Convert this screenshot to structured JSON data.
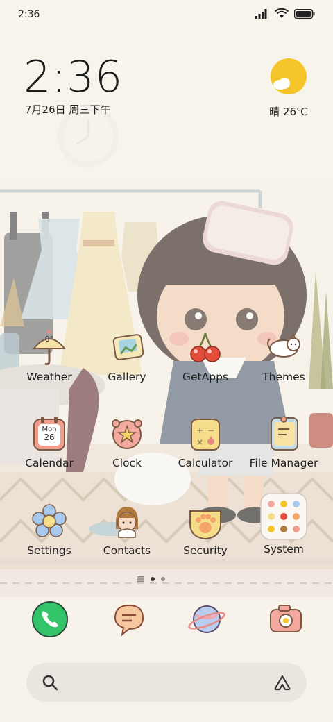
{
  "status_bar": {
    "time": "2:36"
  },
  "widget": {
    "clock": "2:36",
    "date": "7月26日 周三下午",
    "weather_text": "晴 26℃"
  },
  "apps": [
    {
      "label": "Weather",
      "icon": "weather-icon",
      "badge": "0°"
    },
    {
      "label": "Gallery",
      "icon": "gallery-icon"
    },
    {
      "label": "GetApps",
      "icon": "cherry-icon"
    },
    {
      "label": "Themes",
      "icon": "cat-icon"
    },
    {
      "label": "Calendar",
      "icon": "calendar-icon",
      "cal_top": "Mon",
      "cal_day": "26"
    },
    {
      "label": "Clock",
      "icon": "clock-star-icon"
    },
    {
      "label": "Calculator",
      "icon": "calculator-icon"
    },
    {
      "label": "File Manager",
      "icon": "file-manager-icon"
    },
    {
      "label": "Settings",
      "icon": "flower-gear-icon"
    },
    {
      "label": "Contacts",
      "icon": "contacts-icon"
    },
    {
      "label": "Security",
      "icon": "paw-icon"
    },
    {
      "label": "System",
      "icon": "folder-icon"
    }
  ],
  "page_indicator": {
    "pages": 2,
    "current": 1
  },
  "dock": [
    {
      "icon": "phone-icon"
    },
    {
      "icon": "messages-icon"
    },
    {
      "icon": "browser-planet-icon"
    },
    {
      "icon": "camera-icon"
    }
  ],
  "colors": {
    "background": "#f7f3ec",
    "accent": "#f6c52c"
  }
}
